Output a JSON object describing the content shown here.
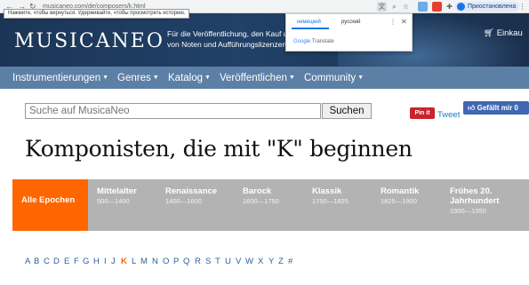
{
  "browser": {
    "url": "musicaneo.com/de/composers/k.html",
    "tooltip": "Нажмите, чтобы вернуться. Удерживайте, чтобы просмотреть историю.",
    "profile_label": "Приостановлена"
  },
  "translate_popup": {
    "source_lang": "немецкий",
    "target_lang": "русский",
    "brand_google": "Google",
    "brand_translate": "Translate"
  },
  "header": {
    "logo": "MUSICANEO",
    "tagline": "Für die Veröffentlichung, den Kauf und Verkauf von Noten und Aufführungslizenzen!",
    "basket_label": "Einkau"
  },
  "nav": {
    "items": [
      {
        "label": "Instrumentierungen"
      },
      {
        "label": "Genres"
      },
      {
        "label": "Katalog"
      },
      {
        "label": "Veröffentlichen"
      },
      {
        "label": "Community"
      }
    ]
  },
  "search": {
    "placeholder": "Suche auf MusicaNeo",
    "button_label": "Suchen"
  },
  "social": {
    "pinit": "Pin it",
    "tweet": "Tweet",
    "fb_like": "Gefällt mir 0"
  },
  "page_title": "Komponisten, die mit \"K\" beginnen",
  "epochs": [
    {
      "name": "Alle Epochen",
      "range": "",
      "active": true
    },
    {
      "name": "Mittelalter",
      "range": "500—1400",
      "active": false
    },
    {
      "name": "Renaissance",
      "range": "1400—1600",
      "active": false
    },
    {
      "name": "Barock",
      "range": "1600—1750",
      "active": false
    },
    {
      "name": "Klassik",
      "range": "1750—1825",
      "active": false
    },
    {
      "name": "Romantik",
      "range": "1825—1900",
      "active": false
    },
    {
      "name": "Frühes 20. Jahrhundert",
      "range": "1900—1950",
      "active": false
    }
  ],
  "alphabet": {
    "letters": [
      "A",
      "B",
      "C",
      "D",
      "E",
      "F",
      "G",
      "H",
      "I",
      "J",
      "K",
      "L",
      "M",
      "N",
      "O",
      "P",
      "Q",
      "R",
      "S",
      "T",
      "U",
      "V",
      "W",
      "X",
      "Y",
      "Z",
      "#"
    ],
    "current": "K"
  },
  "colors": {
    "nav_bg": "#5c7fa5",
    "header_bg": "#1b3556",
    "active_epoch": "#ff6600",
    "epoch_bg": "#b3b3b3",
    "link": "#2b5f9e"
  }
}
